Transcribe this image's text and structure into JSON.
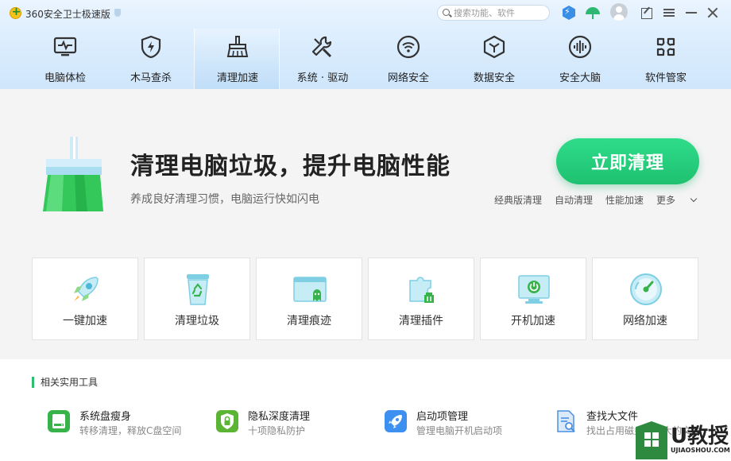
{
  "app": {
    "title": "360安全卫士极速版"
  },
  "search": {
    "placeholder": "搜索功能、软件"
  },
  "nav": {
    "tabs": [
      {
        "label": "电脑体检",
        "icon": "monitor-pulse-icon"
      },
      {
        "label": "木马查杀",
        "icon": "shield-bolt-icon"
      },
      {
        "label": "清理加速",
        "icon": "broom-icon",
        "active": true
      },
      {
        "label": "系统 · 驱动",
        "icon": "wrench-screwdriver-icon"
      },
      {
        "label": "网络安全",
        "icon": "wifi-icon"
      },
      {
        "label": "数据安全",
        "icon": "cube-icon"
      },
      {
        "label": "安全大脑",
        "icon": "brain-wave-icon"
      },
      {
        "label": "软件管家",
        "icon": "apps-icon"
      }
    ]
  },
  "main": {
    "headline": "清理电脑垃圾，提升电脑性能",
    "subline": "养成良好清理习惯，电脑运行快如闪电",
    "clean_button": "立即清理",
    "links": [
      "经典版清理",
      "自动清理",
      "性能加速",
      "更多"
    ]
  },
  "cards": [
    {
      "label": "一键加速",
      "icon": "rocket-icon"
    },
    {
      "label": "清理垃圾",
      "icon": "trash-bin-icon"
    },
    {
      "label": "清理痕迹",
      "icon": "window-ghost-icon"
    },
    {
      "label": "清理插件",
      "icon": "puzzle-icon"
    },
    {
      "label": "开机加速",
      "icon": "power-monitor-icon"
    },
    {
      "label": "网络加速",
      "icon": "gauge-icon"
    }
  ],
  "tools": {
    "title": "相关实用工具",
    "items": [
      {
        "name": "系统盘瘦身",
        "desc": "转移清理，释放C盘空间",
        "icon": "disk-icon",
        "color": "#37b34a"
      },
      {
        "name": "隐私深度清理",
        "desc": "十项隐私防护",
        "icon": "lock-shield-icon",
        "color": "#5bb434"
      },
      {
        "name": "启动项管理",
        "desc": "管理电脑开机启动项",
        "icon": "rocket-icon",
        "color": "#3d8ff0"
      },
      {
        "name": "查找大文件",
        "desc": "找出占用磁盘空间大的文件",
        "icon": "file-search-icon",
        "color": "#4a90e2"
      }
    ]
  },
  "watermark": {
    "text": "U教授",
    "sub": "UJIAOSHOU.COM"
  },
  "colors": {
    "accent_green": "#1ec170",
    "nav_bg": "#d9ecfd",
    "main_bg": "#f4f4f4"
  }
}
